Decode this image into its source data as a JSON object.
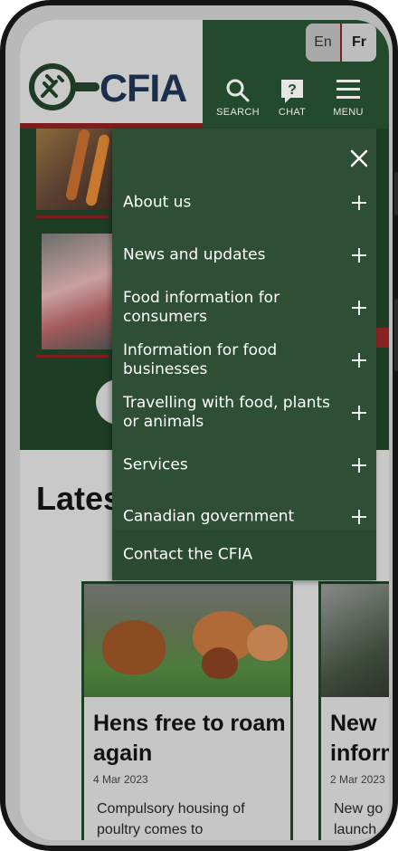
{
  "header": {
    "logo_text": "CFIA",
    "lang_en": "En",
    "lang_fr": "Fr",
    "search_label": "SEARCH",
    "chat_label": "CHAT",
    "menu_label": "MENU"
  },
  "menu": {
    "items": [
      {
        "label": "About us"
      },
      {
        "label": "News and updates"
      },
      {
        "label": "Food information for consumers"
      },
      {
        "label": "Information for food businesses"
      },
      {
        "label": "Travelling with food, plants or animals"
      },
      {
        "label": "Services"
      },
      {
        "label": "Canadian government"
      }
    ],
    "contact_label": "Contact the CFIA"
  },
  "latest": {
    "title": "Lates"
  },
  "cards": [
    {
      "title": "Hens free to roam again",
      "date": "4 Mar 2023",
      "desc": "Compulsory housing of poultry comes to"
    },
    {
      "title": "New inform",
      "date": "2 Mar 2023",
      "desc": "New go launch"
    }
  ],
  "colors": {
    "brand_green": "#244a2e",
    "menu_green": "#2e4f35",
    "accent_red": "#7d1d1d",
    "logo_navy": "#1c2f4a"
  }
}
